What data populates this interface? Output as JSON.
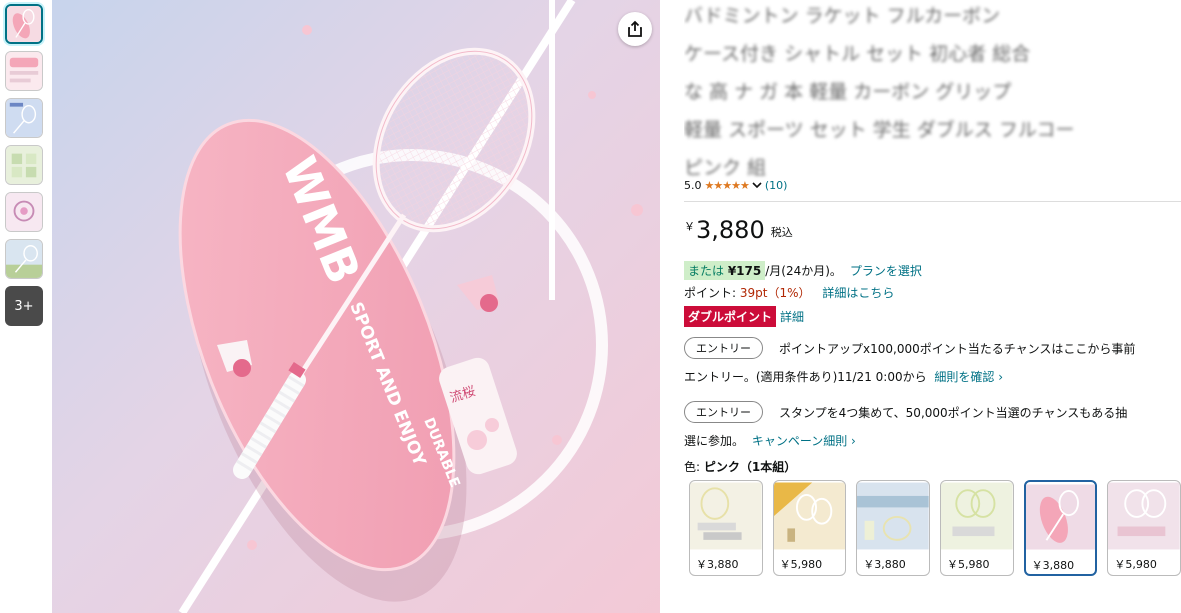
{
  "thumbnails": {
    "more_label": "3+"
  },
  "title_lines": [
    "バドミントン ラケット フルカーボン",
    "ケース付き シャトル セット 初心者 総合",
    "な 高 ナ ガ 本 軽量 カーボン グリップ",
    "軽量 スポーツ セット 学生 ダブルス フルコー",
    "ピンク 組"
  ],
  "rating": {
    "score": "5.0",
    "stars": "★★★★★",
    "count": "(10)"
  },
  "price": {
    "currency": "￥",
    "amount": "3,880",
    "tax_label": "税込"
  },
  "installment": {
    "prefix": "または ",
    "amount": "¥175",
    "suffix": " /月(24か月)。",
    "plan_link": "プランを選択"
  },
  "points": {
    "label": "ポイント: ",
    "value": "39pt（1%）",
    "detail_link": "詳細はこちら"
  },
  "double_point": {
    "badge": "ダブルポイント",
    "detail_link": "詳細"
  },
  "entries": [
    {
      "button": "エントリー",
      "text": "ポイントアップx100,000ポイント当たるチャンスはここから事前",
      "sub_text": "エントリー。(適用条件あり)11/21 0:00から",
      "sub_link": "細則を確認 ›"
    },
    {
      "button": "エントリー",
      "text": "スタンプを4つ集めて、50,000ポイント当選のチャンスもある抽",
      "sub_text": "選に参加。",
      "sub_link": "キャンペーン細則 ›"
    }
  ],
  "color": {
    "label": "色: ",
    "value": "ピンク（1本組）"
  },
  "swatches": [
    {
      "price": "￥3,880",
      "theme": "cream"
    },
    {
      "price": "￥5,980",
      "theme": "yellow"
    },
    {
      "price": "￥3,880",
      "theme": "blue"
    },
    {
      "price": "￥5,980",
      "theme": "green"
    },
    {
      "price": "￥3,880",
      "theme": "pink"
    },
    {
      "price": "￥5,980",
      "theme": "pink-set"
    }
  ],
  "product_image": {
    "brand": "WMB",
    "cover_text_1": "SPORT AND ENJOY",
    "cover_text_2": "DURABLE",
    "tube_text": "流桜",
    "colors": {
      "background_pink": "#f3c9d6",
      "background_blue": "#c7d4ec",
      "cover_pink": "#f4a6b8",
      "accent_pink": "#e46a8c"
    }
  }
}
